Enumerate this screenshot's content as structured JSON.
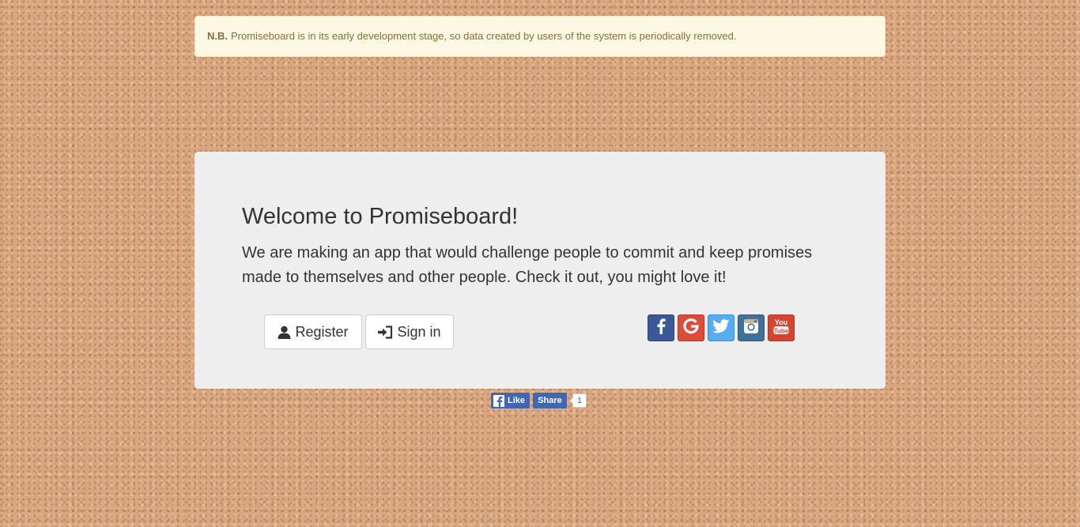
{
  "notice": {
    "prefix": "N.B.",
    "text": "Promiseboard is in its early development stage, so data created by users of the system is periodically removed."
  },
  "welcome": {
    "title": "Welcome to Promiseboard!",
    "description": "We are making an app that would challenge people to commit and keep promises made to themselves and other people. Check it out, you might love it!"
  },
  "actions": {
    "register_label": "Register",
    "signin_label": "Sign in"
  },
  "social": [
    {
      "name": "facebook-icon",
      "color": "#3b5998"
    },
    {
      "name": "google-icon",
      "color": "#dd4b39"
    },
    {
      "name": "twitter-icon",
      "color": "#55acee"
    },
    {
      "name": "instagram-icon",
      "color": "#3f729b"
    },
    {
      "name": "youtube-icon",
      "color": "#d6452f"
    }
  ],
  "facebook_widget": {
    "like_label": "Like",
    "share_label": "Share",
    "count": "1"
  }
}
